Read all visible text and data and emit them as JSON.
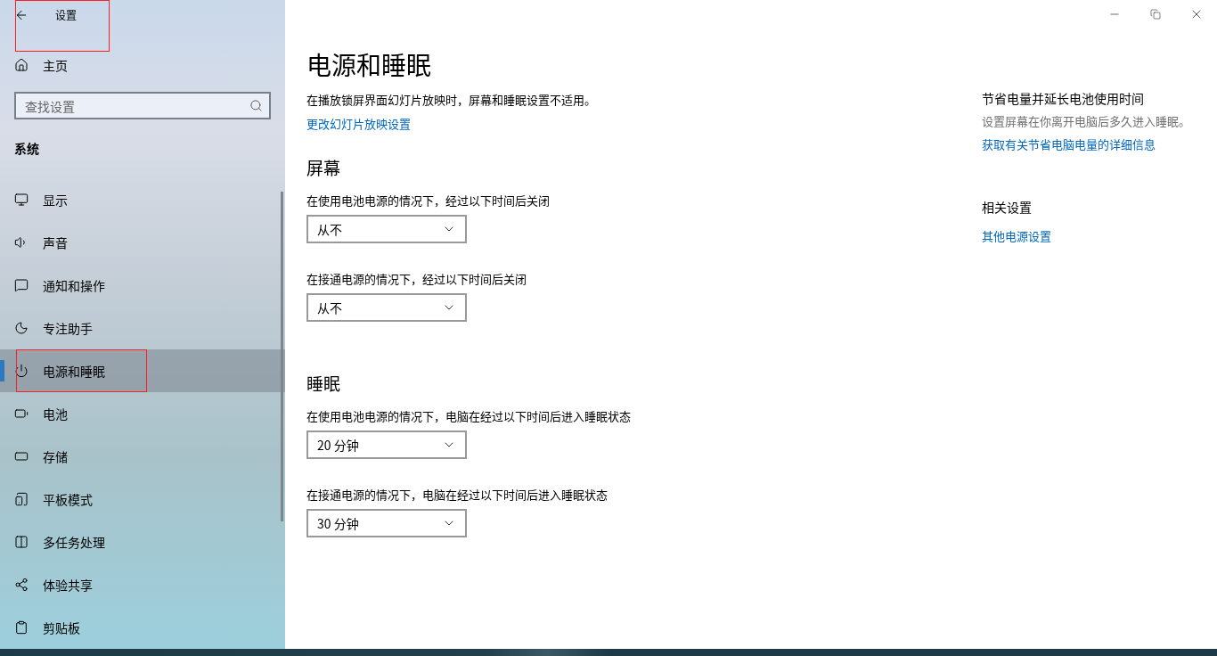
{
  "window": {
    "title": "设置"
  },
  "sidebar": {
    "home": "主页",
    "search": {
      "placeholder": "查找设置"
    },
    "section": "系统",
    "items": [
      {
        "label": "显示",
        "selected": false
      },
      {
        "label": "声音",
        "selected": false
      },
      {
        "label": "通知和操作",
        "selected": false
      },
      {
        "label": "专注助手",
        "selected": false
      },
      {
        "label": "电源和睡眠",
        "selected": true
      },
      {
        "label": "电池",
        "selected": false
      },
      {
        "label": "存储",
        "selected": false
      },
      {
        "label": "平板模式",
        "selected": false
      },
      {
        "label": "多任务处理",
        "selected": false
      },
      {
        "label": "体验共享",
        "selected": false
      },
      {
        "label": "剪贴板",
        "selected": false
      }
    ]
  },
  "main": {
    "title": "电源和睡眠",
    "notice": "在播放锁屏界面幻灯片放映时，屏幕和睡眠设置不适用。",
    "notice_link": "更改幻灯片放映设置",
    "sections": [
      {
        "heading": "屏幕",
        "settings": [
          {
            "label": "在使用电池电源的情况下，经过以下时间后关闭",
            "value": "从不"
          },
          {
            "label": "在接通电源的情况下，经过以下时间后关闭",
            "value": "从不"
          }
        ]
      },
      {
        "heading": "睡眠",
        "settings": [
          {
            "label": "在使用电池电源的情况下，电脑在经过以下时间后进入睡眠状态",
            "value": "20 分钟"
          },
          {
            "label": "在接通电源的情况下，电脑在经过以下时间后进入睡眠状态",
            "value": "30 分钟"
          }
        ]
      }
    ]
  },
  "aside": {
    "groups": [
      {
        "heading": "节省电量并延长电池使用时间",
        "text": "设置屏幕在你离开电脑后多久进入睡眠。",
        "link": "获取有关节省电脑电量的详细信息"
      },
      {
        "heading": "相关设置",
        "link": "其他电源设置"
      }
    ]
  }
}
